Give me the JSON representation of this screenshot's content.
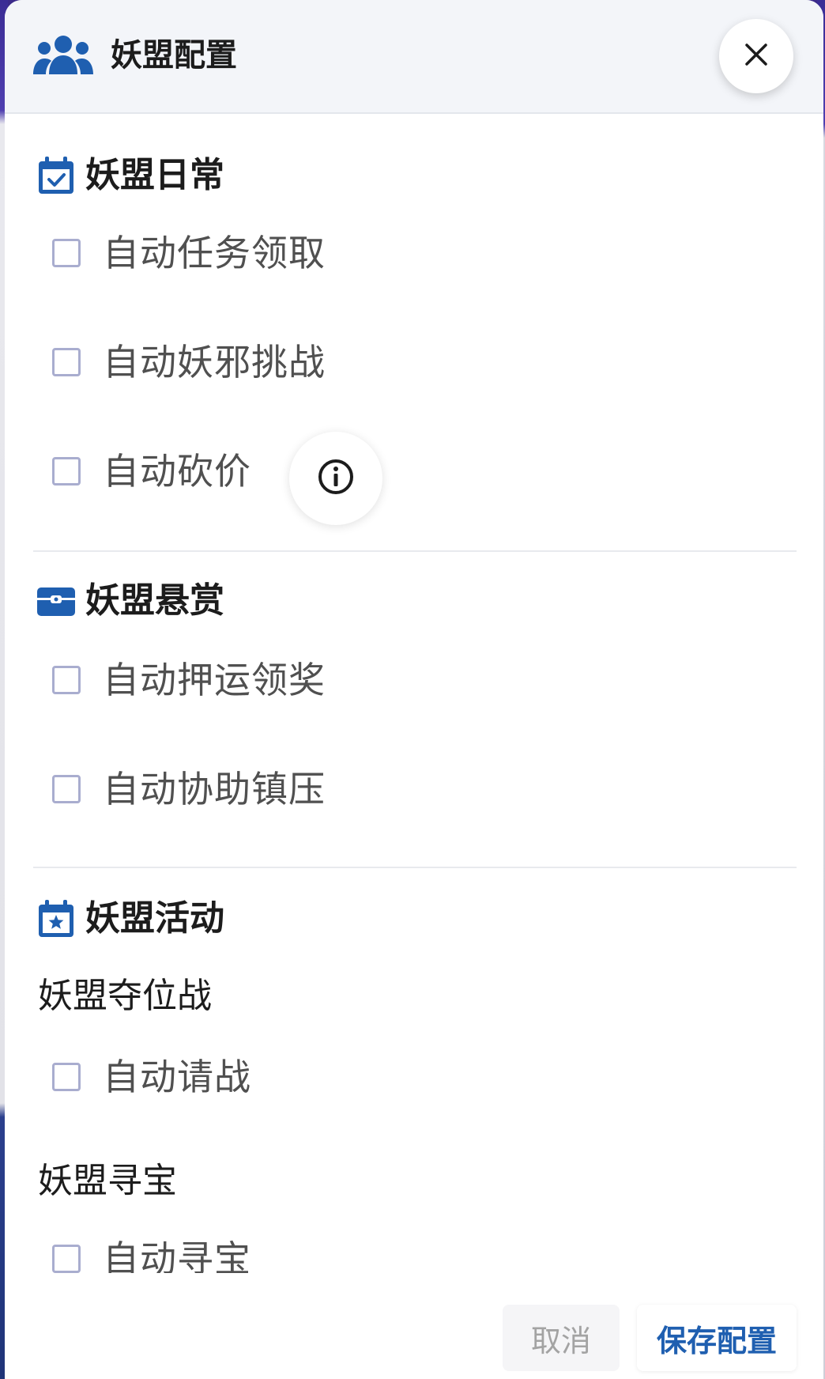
{
  "dialog": {
    "title": "妖盟配置",
    "title_icon": "users-icon",
    "close_icon": "close-icon"
  },
  "sections": {
    "daily": {
      "title": "妖盟日常",
      "icon": "calendar-check-icon",
      "options": [
        {
          "label": "自动任务领取",
          "checked": false
        },
        {
          "label": "自动妖邪挑战",
          "checked": false
        },
        {
          "label": "自动砍价",
          "checked": false
        }
      ],
      "info_icon": "info-icon"
    },
    "bounty": {
      "title": "妖盟悬赏",
      "icon": "toolbox-icon",
      "options": [
        {
          "label": "自动押运领奖",
          "checked": false
        },
        {
          "label": "自动协助镇压",
          "checked": false
        }
      ]
    },
    "activity": {
      "title": "妖盟活动",
      "icon": "calendar-star-icon",
      "groups": [
        {
          "title": "妖盟夺位战",
          "options": [
            {
              "label": "自动请战",
              "checked": false
            }
          ]
        },
        {
          "title": "妖盟寻宝",
          "options": [
            {
              "label": "自动寻宝",
              "checked": false
            }
          ]
        }
      ]
    }
  },
  "footer": {
    "cancel_label": "取消",
    "save_label": "保存配置"
  },
  "colors": {
    "accent": "#1f5fb0",
    "checkbox_border": "#a9adcf",
    "header_bg": "#f3f5f9"
  }
}
